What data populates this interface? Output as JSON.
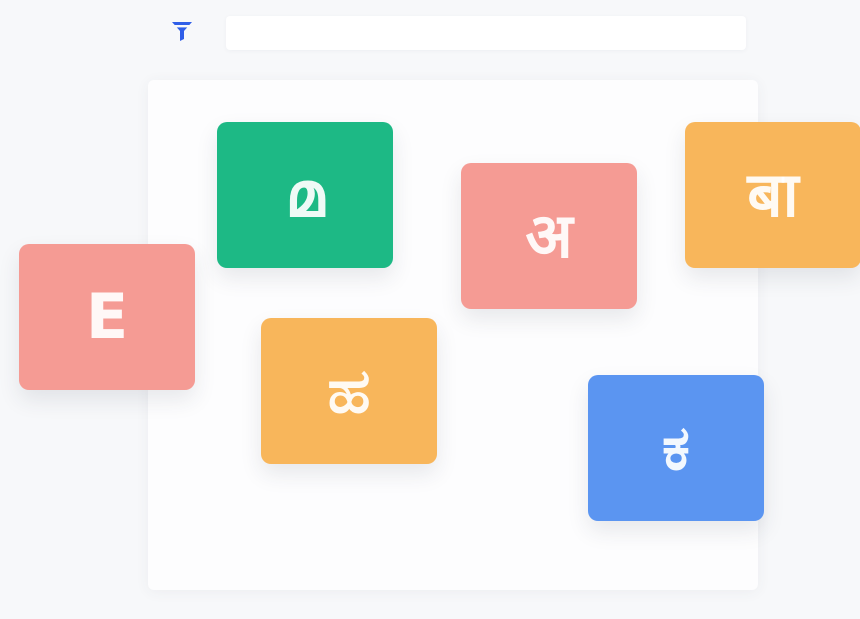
{
  "toolbar": {
    "filter_icon": "filter-icon",
    "filter_color": "#2f5ee8"
  },
  "tiles": [
    {
      "id": "e",
      "glyph": "E",
      "color": "#f59b94"
    },
    {
      "id": "ml",
      "glyph": "മ",
      "color": "#1db985"
    },
    {
      "id": "hi",
      "glyph": "अ",
      "color": "#f59b94"
    },
    {
      "id": "mr",
      "glyph": "बा",
      "color": "#f8b65b"
    },
    {
      "id": "kn",
      "glyph": "ಹ",
      "color": "#f8b65b"
    },
    {
      "id": "ke",
      "glyph": "ಕ",
      "color": "#5b95f1"
    }
  ]
}
